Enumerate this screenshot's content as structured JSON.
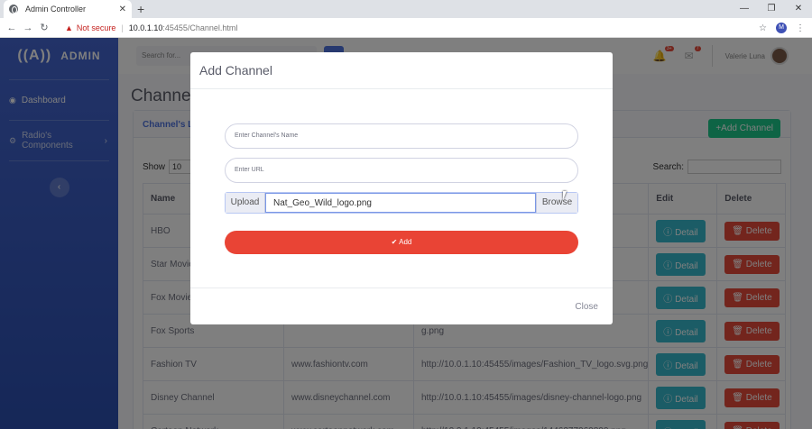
{
  "browser": {
    "tab_title": "Admin Controller",
    "close": "✕",
    "newtab": "+",
    "win": [
      "—",
      "❐",
      "✕"
    ],
    "nav": [
      "←",
      "→",
      "↻"
    ],
    "warning_icon": "▲",
    "not_secure": "Not secure",
    "separator": "|",
    "url_host": "10.0.1.10",
    "url_path": ":45455/Channel.html",
    "star": "☆",
    "menu": "⋮",
    "avatar": "M"
  },
  "sidebar": {
    "brand_icon": "((A))",
    "brand": "ADMIN",
    "items": [
      {
        "icon": "◉",
        "label": "Dashboard"
      },
      {
        "icon": "⚙",
        "label": "Radio's Components",
        "chevron": "›"
      }
    ],
    "toggle": "‹"
  },
  "topbar": {
    "search_placeholder": "Search for...",
    "alerts_badge": "3+",
    "messages_badge": "7",
    "bell": "🔔",
    "mail": "✉",
    "user_name": "Valerie Luna"
  },
  "page": {
    "title": "Channel's",
    "card_header": "Channel's Li",
    "add_channel": "+Add Channel",
    "show_label": "Show",
    "show_value": "10",
    "search_label": "Search:",
    "headers": [
      "Name",
      "",
      "",
      "Edit",
      "Delete"
    ],
    "rows": [
      {
        "name": "HBO",
        "site": "",
        "logo": ""
      },
      {
        "name": "Star Movies",
        "site": "",
        "logo": "g"
      },
      {
        "name": "Fox Movie",
        "site": "",
        "logo": "g"
      },
      {
        "name": "Fox Sports",
        "site": "",
        "logo": "g.png"
      },
      {
        "name": "Fashion TV",
        "site": "www.fashiontv.com",
        "logo": "http://10.0.1.10:45455/images/Fashion_TV_logo.svg.png"
      },
      {
        "name": "Disney Channel",
        "site": "www.disneychannel.com",
        "logo": "http://10.0.1.10:45455/images/disney-channel-logo.png"
      },
      {
        "name": "Cartoon Network",
        "site": "www.cartoonnetwork.com",
        "logo": "http://10.0.1.10:45455/images/1446377060800.png"
      }
    ],
    "detail_label": "ⓘ Detail",
    "delete_label": "🗑 Delete"
  },
  "modal": {
    "title": "Add Channel",
    "name_placeholder": "Enter Channel's Name",
    "url_placeholder": "Enter URL",
    "upload_label": "Upload",
    "file_name": "Nat_Geo_Wild_logo.png",
    "browse_label": "Browse",
    "add_label": "✔ Add",
    "close_label": "Close"
  },
  "colors": {
    "primary": "#4e73df",
    "success": "#1cc88a",
    "danger": "#e74a3b",
    "info": "#36b9cc"
  }
}
